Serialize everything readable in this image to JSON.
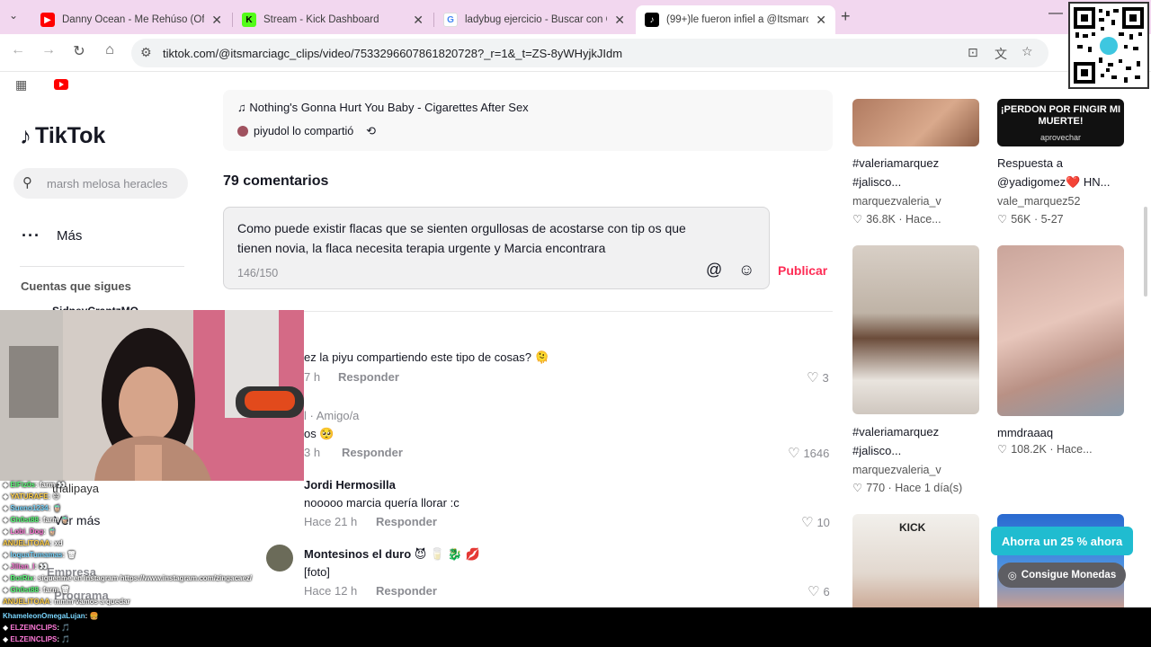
{
  "browser": {
    "tabs": [
      {
        "title": "Danny Ocean - Me Rehúso (Offi",
        "favicon": "youtube-icon",
        "color": "#ff0000"
      },
      {
        "title": "Stream - Kick Dashboard",
        "favicon": "kick-icon",
        "color": "#53fc18"
      },
      {
        "title": "ladybug ejercicio - Buscar con G",
        "favicon": "google-icon",
        "color": "#4285f4"
      },
      {
        "title": "(99+)le fueron infiel a @Itsmarc",
        "favicon": "tiktok-icon",
        "color": "#000000"
      }
    ],
    "url": "tiktok.com/@itsmarciagc_clips/video/7533296607861820728?_r=1&_t=ZS-8yWHyjkJIdm"
  },
  "sidebar": {
    "logo_text": "TikTok",
    "search_placeholder": "marsh melosa heracles",
    "more_label": "Más",
    "following_heading": "Cuentas que sigues",
    "following_partial": "SidneyCrantzMO",
    "follow_item": "thalipaya",
    "see_more": "Ver más",
    "company": "Empresa",
    "program": "Programa"
  },
  "post": {
    "song": "♫ Nothing's Gonna Hurt You Baby - Cigarettes After Sex",
    "shared_by": "piyudol lo compartió",
    "repost_icon": "⟲"
  },
  "comments": {
    "count_label": "79 comentarios",
    "draft_text": "Como puede existir flacas que se sienten orgullosas de acostarse con tip os que tienen novia, la flaca necesita terapia urgente y Marcia encontrara",
    "char_count": "146/150",
    "publish_label": "Publicar",
    "items": [
      {
        "text": "ez la piyu compartiendo este tipo de cosas? 🫠",
        "time": "7 h",
        "reply": "Responder",
        "likes": "3"
      },
      {
        "name": "l · Amigo/a",
        "text": "os 🥺",
        "time": "3 h",
        "reply": "Responder",
        "likes": "1646"
      },
      {
        "name": "Jordi Hermosilla",
        "text": "nooooo marcia quería llorar :c",
        "time": "Hace 21 h",
        "reply": "Responder",
        "likes": "10"
      },
      {
        "name": "Montesinos el duro 😈 🥛 🐉 💋",
        "text": "[foto]",
        "time": "Hace 12 h",
        "reply": "Responder",
        "likes": "6"
      }
    ]
  },
  "related": [
    {
      "caption": "#valeriamarquez #jalisco...",
      "author": "marquezvaleria_v",
      "likes": "36.8K",
      "when": "Hace..."
    },
    {
      "caption": "Respuesta a @yadigomez❤️ HN...",
      "author": "vale_marquez52",
      "likes": "56K",
      "when": "5-27",
      "thumb_text": "¡PERDON POR FINGIR MI MUERTE!",
      "thumb_sub": "aprovechar"
    },
    {
      "caption": "#valeriamarquez #jalisco...",
      "author": "marquezvaleria_v",
      "likes": "770",
      "when": "Hace 1 día(s)"
    },
    {
      "caption": "mmdraaaq",
      "author": "",
      "likes": "108.2K",
      "when": "Hace..."
    }
  ],
  "promo": {
    "label": "Ahorra un 25 % ahora",
    "coins": "Consigue Monedas"
  },
  "chat": [
    {
      "user": "ElFiz0s",
      "msg": "farm 👀"
    },
    {
      "user": "YATURAFE",
      "msg": "😄"
    },
    {
      "user": "Sueno1234",
      "msg": "🧋"
    },
    {
      "user": "Gh0st88",
      "msg": "farm 🧋"
    },
    {
      "user": "Lobi_Dog",
      "msg": "🧋"
    },
    {
      "user": "ANUELITOAA",
      "msg": "xd"
    },
    {
      "user": "loquaTumamas",
      "msg": "🗑"
    },
    {
      "user": "Jilian_l",
      "msg": "👀"
    },
    {
      "user": "BotRix",
      "msg": "siguenme en instagram https://www.instagram.com/zingacaez/"
    },
    {
      "user": "Gh0st88",
      "msg": "farm 🗑"
    },
    {
      "user": "ANUELITOAA",
      "msg": "mmm vamos a quedar"
    },
    {
      "user": "KhameleonOmegaLujan",
      "msg": "🍔"
    },
    {
      "user": "ELZEINCLIPS",
      "msg": "🎵"
    },
    {
      "user": "ELZEINCLIPS",
      "msg": "🎵"
    }
  ]
}
